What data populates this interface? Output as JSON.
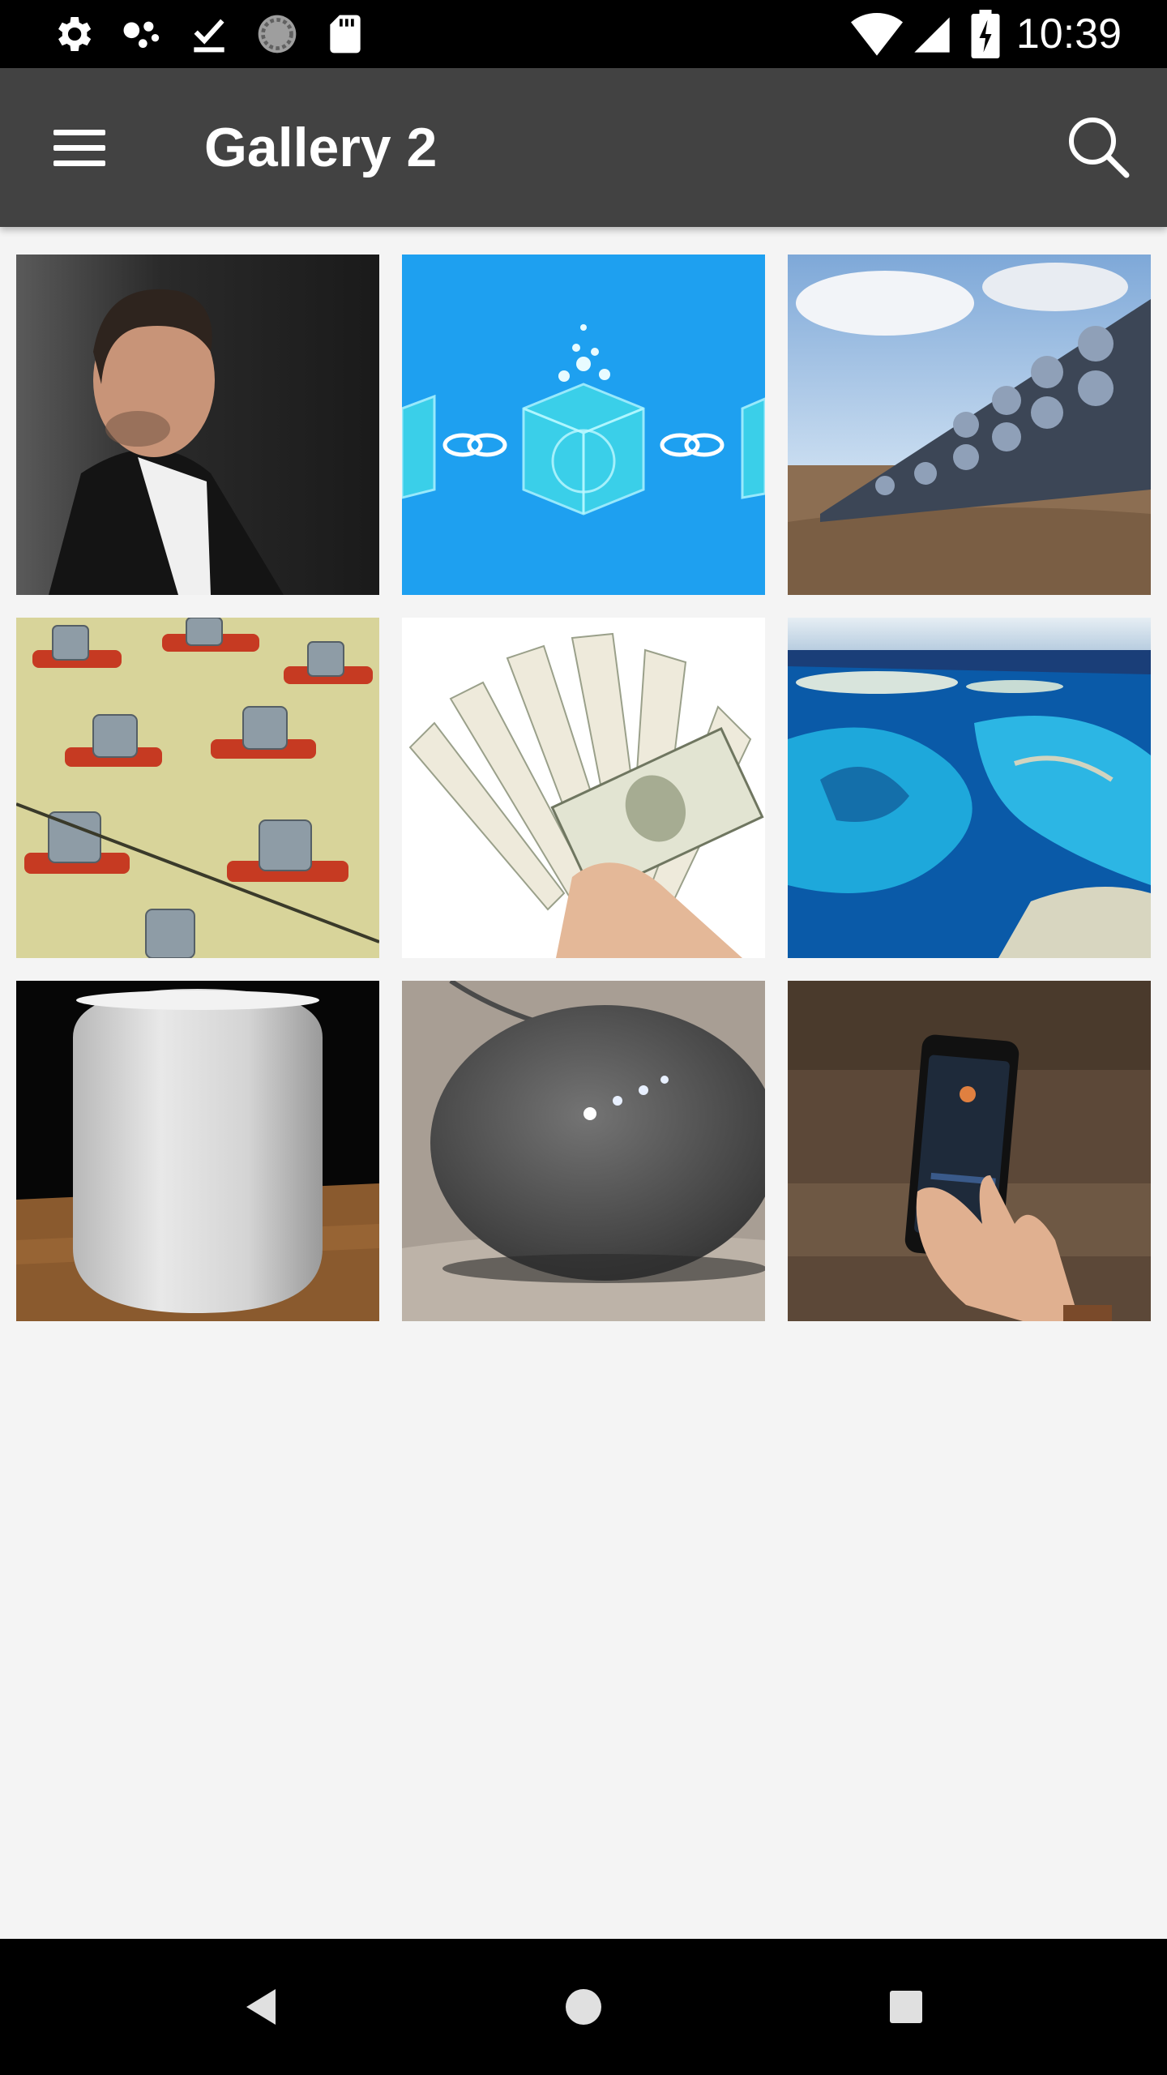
{
  "status_bar": {
    "time": "10:39",
    "icons": [
      "settings-gear-icon",
      "assistant-dots-icon",
      "download-done-icon",
      "sync-circle-icon",
      "sd-card-icon",
      "wifi-icon",
      "cell-signal-icon",
      "battery-charging-icon"
    ]
  },
  "app_bar": {
    "title": "Gallery 2",
    "menu_icon": "hamburger-menu-icon",
    "search_icon": "search-icon"
  },
  "gallery": {
    "items": [
      {
        "subject": "man-in-suit-portrait"
      },
      {
        "subject": "blockchain-cubes-illustration"
      },
      {
        "subject": "carbon-capture-fan-wall"
      },
      {
        "subject": "battery-cell-array"
      },
      {
        "subject": "fan-of-hundred-dollar-bills"
      },
      {
        "subject": "aerial-coral-reef"
      },
      {
        "subject": "white-smart-speaker"
      },
      {
        "subject": "grey-smart-speaker"
      },
      {
        "subject": "hand-holding-smartphone"
      }
    ]
  },
  "nav_bar": {
    "buttons": [
      "back-icon",
      "home-icon",
      "recents-icon"
    ]
  }
}
